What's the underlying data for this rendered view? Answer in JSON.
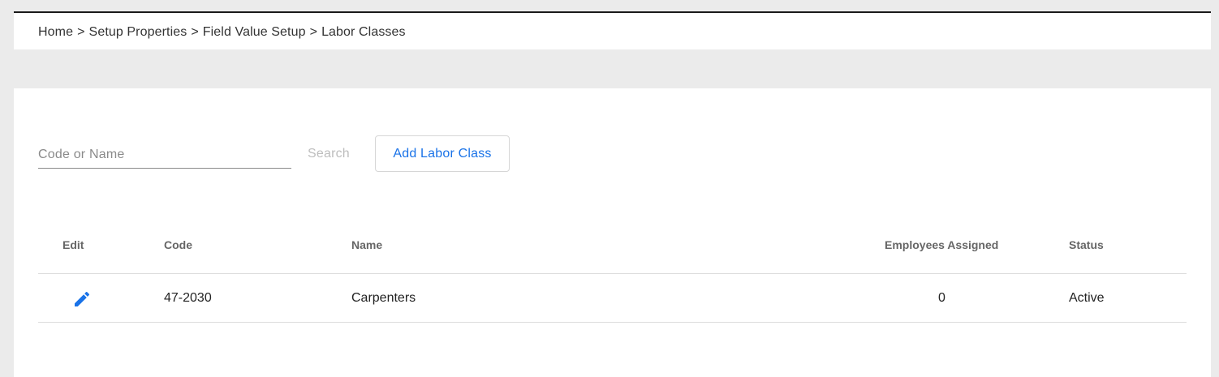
{
  "breadcrumb": {
    "items": [
      "Home",
      "Setup Properties",
      "Field Value Setup",
      "Labor Classes"
    ],
    "separator": ">"
  },
  "search": {
    "placeholder": "Code or Name",
    "value": "",
    "button_label": "Search"
  },
  "actions": {
    "add_label": "Add Labor Class"
  },
  "table": {
    "headers": {
      "edit": "Edit",
      "code": "Code",
      "name": "Name",
      "employees": "Employees Assigned",
      "status": "Status"
    },
    "rows": [
      {
        "edit_icon": "pencil-icon",
        "code": "47-2030",
        "name": "Carpenters",
        "employees": "0",
        "status": "Active"
      }
    ]
  },
  "colors": {
    "accent": "#1a73e8",
    "background": "#ebebeb",
    "panel": "#ffffff"
  }
}
